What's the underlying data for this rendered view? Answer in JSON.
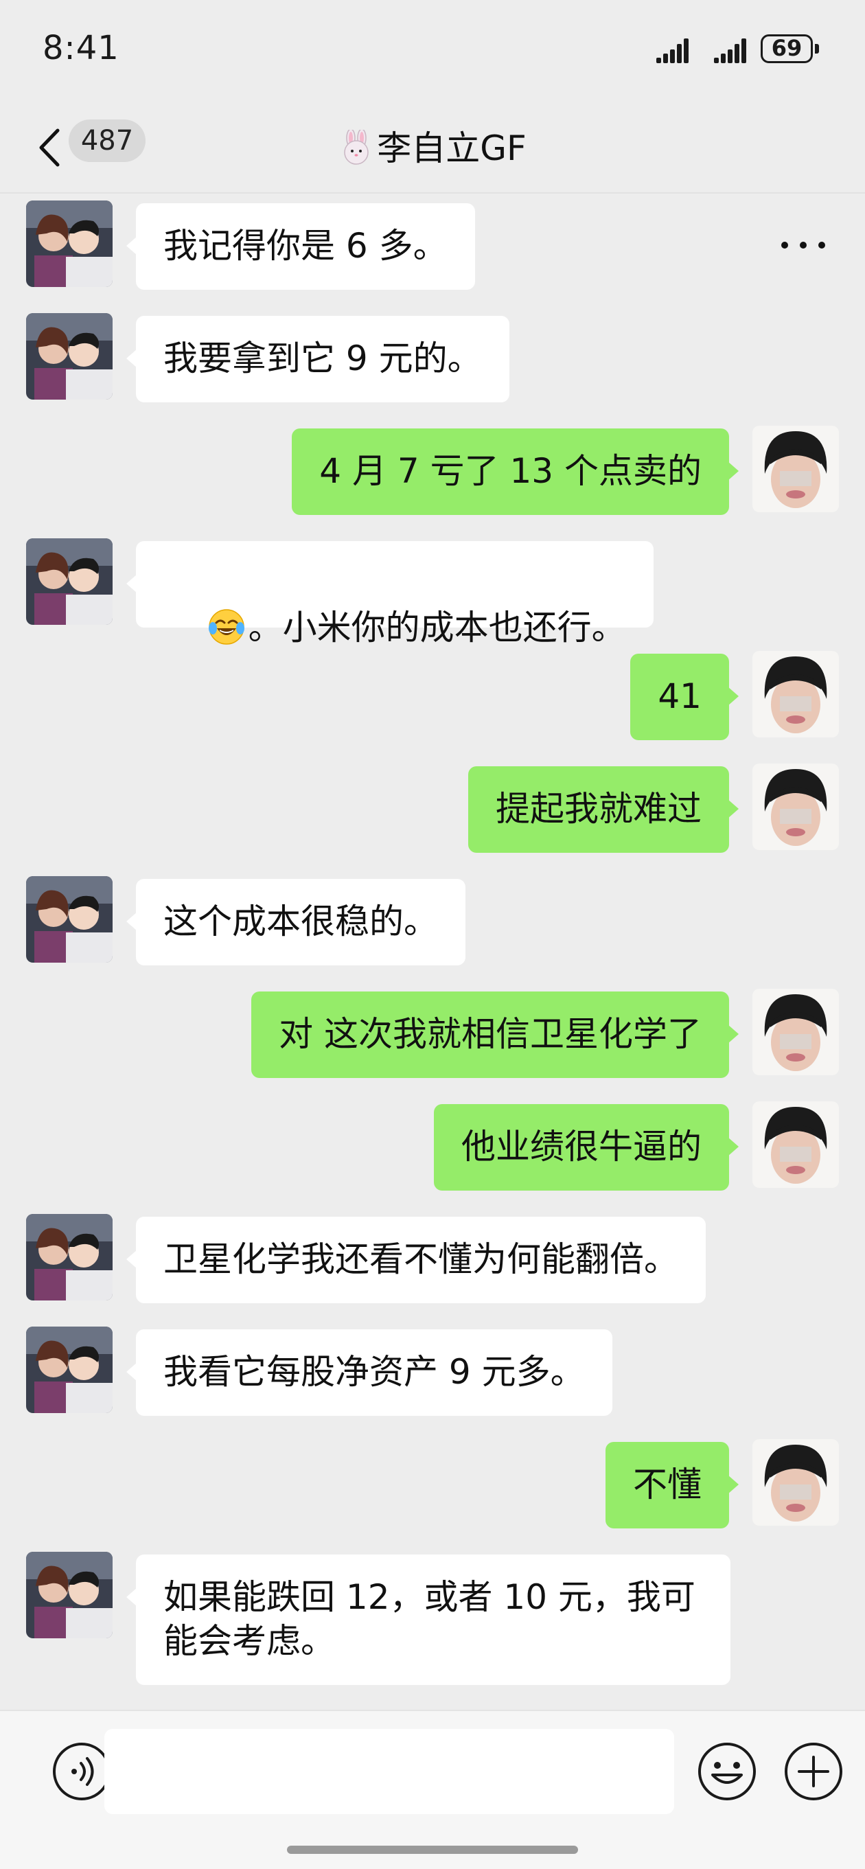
{
  "status_bar": {
    "time": "8:41",
    "battery": "69"
  },
  "header": {
    "back_label": "back",
    "unread_count": "487",
    "title_emoji": "rabbit-face-icon",
    "title": "李自立GF",
    "more_label": "more"
  },
  "messages": [
    {
      "side": "in",
      "text": "我记得你是 6 多。"
    },
    {
      "side": "in",
      "text": "我要拿到它 9 元的。"
    },
    {
      "side": "out",
      "text": "4 月 7 亏了 13 个点卖的"
    },
    {
      "side": "in",
      "emoji": "tears-of-joy-emoji",
      "text": "。小米你的成本也还行。"
    },
    {
      "side": "out",
      "text": "41"
    },
    {
      "side": "out",
      "text": "提起我就难过"
    },
    {
      "side": "in",
      "text": "这个成本很稳的。"
    },
    {
      "side": "out",
      "text": "对 这次我就相信卫星化学了"
    },
    {
      "side": "out",
      "text": "他业绩很牛逼的"
    },
    {
      "side": "in",
      "text": "卫星化学我还看不懂为何能翻倍。"
    },
    {
      "side": "in",
      "text": "我看它每股净资产 9 元多。"
    },
    {
      "side": "out",
      "text": "不懂"
    },
    {
      "side": "in",
      "text": "如果能跌回 12，或者 10 元，我可\n能会考虑。"
    }
  ],
  "input": {
    "value": "",
    "placeholder": ""
  },
  "colors": {
    "outgoing_bubble": "#95ec69",
    "incoming_bubble": "#ffffff",
    "background": "#ededed"
  }
}
